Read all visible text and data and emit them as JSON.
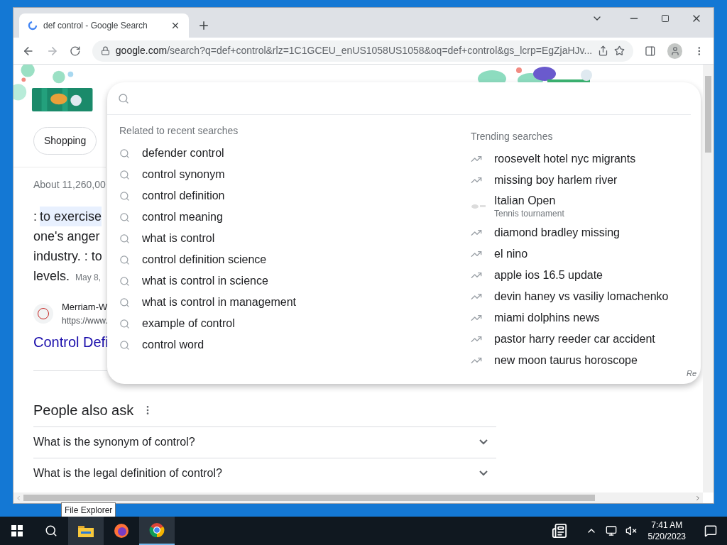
{
  "window": {
    "tab_title": "def control - Google Search",
    "url_host": "google.com",
    "url_path": "/search?q=def+control&rlz=1C1GCEU_enUS1058US1058&oq=def+control&gs_lcrp=EgZjaHJv..."
  },
  "page": {
    "chips": [
      "Shopping"
    ],
    "results_count": "About 11,260,00",
    "definition": {
      "prefix": ":",
      "highlighted": "to exercise",
      "lines": [
        "one's anger",
        "industry. : to",
        "levels."
      ],
      "date": "May 8,"
    },
    "source": {
      "name": "Merriam-W",
      "url": "https://www.",
      "title": "Control Defi"
    },
    "people_also_ask": {
      "title": "People also ask",
      "questions": [
        {
          "text": "What is the synonym of control?",
          "expanded": false
        },
        {
          "text": "What is the legal definition of control?",
          "expanded": false
        }
      ]
    }
  },
  "suggestions": {
    "recent_heading": "Related to recent searches",
    "recent": [
      "defender control",
      "control synonym",
      "control definition",
      "control meaning",
      "what is control",
      "control definition science",
      "what is control in science",
      "what is control in management",
      "example of control",
      "control word"
    ],
    "trending_heading": "Trending searches",
    "trending": [
      {
        "kind": "trend",
        "text": "roosevelt hotel nyc migrants"
      },
      {
        "kind": "trend",
        "text": "missing boy harlem river"
      },
      {
        "kind": "picture",
        "text": "Italian Open",
        "subtitle": "Tennis tournament"
      },
      {
        "kind": "trend",
        "text": "diamond bradley missing"
      },
      {
        "kind": "trend",
        "text": "el nino"
      },
      {
        "kind": "trend",
        "text": "apple ios 16.5 update"
      },
      {
        "kind": "trend",
        "text": "devin haney vs vasiliy lomachenko"
      },
      {
        "kind": "trend",
        "text": "miami dolphins news"
      },
      {
        "kind": "trend",
        "text": "pastor harry reeder car accident"
      },
      {
        "kind": "trend",
        "text": "new moon taurus horoscope"
      }
    ],
    "footer": "Re"
  },
  "taskbar": {
    "tooltip": "File Explorer",
    "time": "7:41 AM",
    "date": "5/20/2023"
  }
}
